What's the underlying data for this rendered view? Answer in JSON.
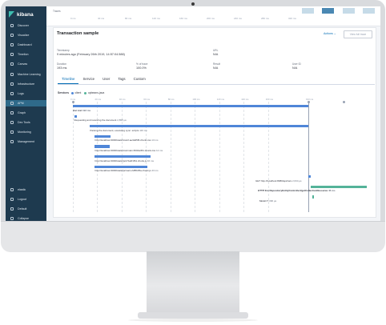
{
  "app": {
    "name": "kibana"
  },
  "sidebar": {
    "items": [
      {
        "label": "Discover"
      },
      {
        "label": "Visualize"
      },
      {
        "label": "Dashboard"
      },
      {
        "label": "Timelion"
      },
      {
        "label": "Canvas"
      },
      {
        "label": "Machine Learning"
      },
      {
        "label": "Infrastructure"
      },
      {
        "label": "Logs"
      },
      {
        "label": "APM"
      },
      {
        "label": "Graph"
      },
      {
        "label": "Dev Tools"
      },
      {
        "label": "Monitoring"
      },
      {
        "label": "Management"
      }
    ],
    "bottom_items": [
      {
        "label": "elastic"
      },
      {
        "label": "Logout"
      },
      {
        "label": "Default"
      },
      {
        "label": "Collapse"
      }
    ],
    "active_item": "APM"
  },
  "distribution": {
    "label": "Traces",
    "ticks": [
      "0 ms",
      "40 ms",
      "80 ms",
      "120 ms",
      "160 ms",
      "200 ms",
      "240 ms",
      "280 ms",
      "320 ms"
    ],
    "colors": {
      "light": "#c6dbe8",
      "dark": "#4a88b3"
    }
  },
  "transaction": {
    "title": "Transaction sample",
    "actions_label": "Actions ⌄",
    "view_full_trace": "View full trace",
    "timestamp_label": "Timestamp",
    "timestamp_value": "9 minutes ago (February 26th 2019, 14:57:04.588)",
    "url_label": "URL",
    "url_value": "N/A",
    "duration_label": "Duration",
    "duration_value": "193 ms",
    "pct_label": "% of trace",
    "pct_value": "100.0%",
    "result_label": "Result",
    "result_value": "N/A",
    "user_label": "User ID",
    "user_value": "N/A"
  },
  "tabs": [
    "Timeline",
    "Service",
    "User",
    "Tags",
    "Custom"
  ],
  "selected_tab": "Timeline",
  "waterfall": {
    "services_label": "Services",
    "legend": [
      {
        "name": "client",
        "color": "#4f86d8"
      },
      {
        "name": "opbeans-java",
        "color": "#54b399"
      }
    ],
    "ticks": [
      "0 ms",
      "20 ms",
      "40 ms",
      "60 ms",
      "80 ms",
      "100 ms",
      "120 ms",
      "140 ms",
      "160 ms",
      "193 ms"
    ],
    "total_duration_label": "193 ms",
    "spans": [
      {
        "name": "Car List",
        "duration": "193 ms",
        "start": 0,
        "end": 193,
        "color": "#4f86d8",
        "label_bold": true
      },
      {
        "name": "Requesting and receiving the document",
        "duration": "2,895 μs",
        "start": 1,
        "end": 3,
        "color": "#4f86d8"
      },
      {
        "name": "Parsing the document, executing sync. scripts",
        "duration": "116 ms",
        "start": 14,
        "end": 193,
        "color": "#4f86d8"
      },
      {
        "name": "http://localhost:3000/static/css/2.ae3dd5f6.chunk.css",
        "duration": "13 ms",
        "start": 18,
        "end": 31,
        "color": "#4f86d8"
      },
      {
        "name": "http://localhost:3000/static/css/main.6640a361.chunk.css",
        "duration": "12 ms",
        "start": 18,
        "end": 30,
        "color": "#4f86d8"
      },
      {
        "name": "http://localhost:3000/static/js/2.5a4f1f61.chunk.js",
        "duration": "46 ms",
        "start": 18,
        "end": 64,
        "color": "#4f86d8"
      },
      {
        "name": "http://localhost:3000/static/js/main.2df5b35a.chunk.js",
        "duration": "43 ms",
        "start": 18,
        "end": 61,
        "color": "#4f86d8"
      },
      {
        "name": "GET http://localhost:8080/api/cars",
        "duration": "2,634 μs",
        "start": 193,
        "end": 195,
        "color": "#4f86d8"
      },
      {
        "name": "HTTP 2xx  RepositoryEntityController#getCollectionResource",
        "duration": "46 ms",
        "start": 195,
        "end": 241,
        "color": "#54b399",
        "label_bold": true
      },
      {
        "name": "SELECT",
        "duration": "396 μs",
        "start": 196,
        "end": 197,
        "color": "#54b399"
      }
    ]
  }
}
